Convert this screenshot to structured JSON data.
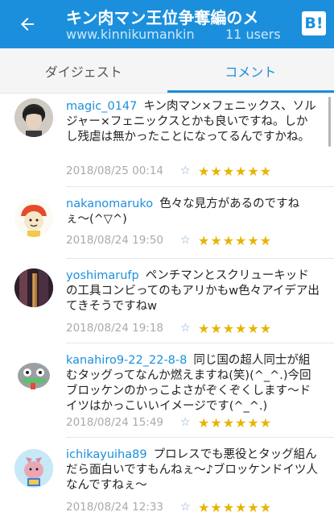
{
  "header": {
    "title": "キン肉マン王位争奪編のメ",
    "url": "www.kinnikumankin",
    "users": "11 users",
    "hatena_label": "B!"
  },
  "tabs": [
    {
      "label": "ダイジェスト",
      "active": false
    },
    {
      "label": "コメント",
      "active": true
    }
  ],
  "comments": [
    {
      "user": "magic_0147",
      "text": "キン肉マン×フェニックス、ソルジャー×フェニックスとかも良いですね。しかし残虐は無かったことになってるんですかね。",
      "date": "2018/08/25 00:14",
      "stars": "★★★★★★"
    },
    {
      "user": "nakanomaruko",
      "text": "色々な見方があるのですねぇ〜(^▽^)",
      "date": "2018/08/24 19:50",
      "stars": "★★★★★★"
    },
    {
      "user": "yoshimarufp",
      "text": "ペンチマンとスクリューキッドの工具コンビってのもアリかもw色々アイデア出てきそうですねw",
      "date": "2018/08/24 19:18",
      "stars": "★★★★★★"
    },
    {
      "user": "kanahiro9-22_22-8-8",
      "text": "同じ国の超人同士が組むタッグってなんか燃えますね(笑)(^_^.)今回ブロッケンのかっこよさがぞくぞくします〜ドイツはかっこいいイメージです(^_^.)",
      "date": "2018/08/24 15:49",
      "stars": "★★★★★★"
    },
    {
      "user": "ichikayuiha89",
      "text": "プロレスでも悪役とタッグ組んだら面白いですもんねぇ〜♪ブロッケンドイツ人なんですねぇ〜",
      "date": "2018/08/24 12:33",
      "stars": "★★★★★★"
    }
  ],
  "icons": {
    "back": "arrow-left-icon",
    "add_star": "add-star-icon"
  },
  "colors": {
    "brand": "#1b8fdc",
    "star": "#e8b400"
  }
}
